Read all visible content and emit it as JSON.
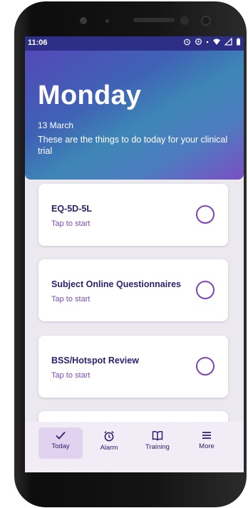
{
  "status_bar": {
    "time": "11:06"
  },
  "header": {
    "day": "Monday",
    "date": "13 March",
    "subtitle": "These are the things to do today for your clinical trial"
  },
  "tasks": [
    {
      "title": "EQ-5D-5L",
      "subtitle": "Tap to start"
    },
    {
      "title": "Subject Online Questionnaires",
      "subtitle": "Tap to start"
    },
    {
      "title": "BSS/Hotspot Review",
      "subtitle": "Tap to start"
    }
  ],
  "bottom_nav": [
    {
      "label": "Today",
      "icon": "check-icon",
      "active": true
    },
    {
      "label": "Alarm",
      "icon": "alarm-clock-icon",
      "active": false
    },
    {
      "label": "Training",
      "icon": "book-icon",
      "active": false
    },
    {
      "label": "More",
      "icon": "menu-icon",
      "active": false
    }
  ],
  "colors": {
    "status_bar": "#2d2f86",
    "title_text": "#2b2170",
    "accent_purple": "#7d45b5",
    "nav_active": "#e1d3ef"
  }
}
